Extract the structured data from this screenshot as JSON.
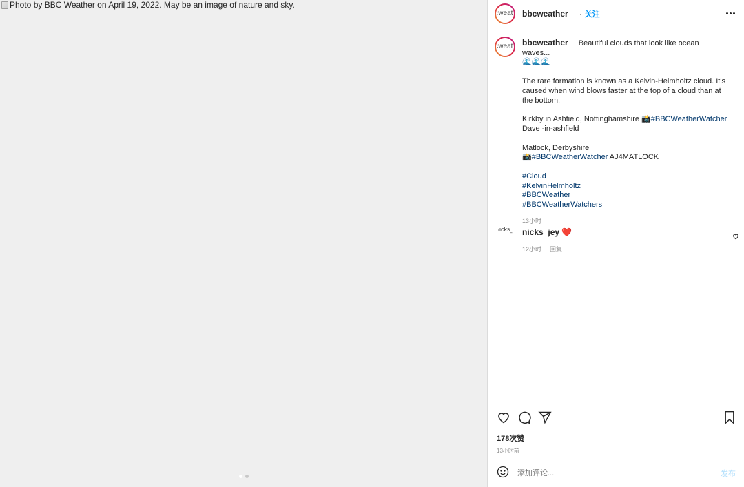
{
  "photo": {
    "alt": "Photo by BBC Weather on April 19, 2022. May be an image of nature and sky.",
    "carousel": {
      "count": 2,
      "active_index": 0
    }
  },
  "header": {
    "username": "bbcweather",
    "avatar_alt": "bbcweather",
    "separator": "·",
    "follow_label": "关注",
    "more_icon": "more-horizontal-icon"
  },
  "caption": {
    "avatar_alt": "bbcweather",
    "username": "bbcweather",
    "line1": "Beautiful clouds that look like ocean waves...",
    "emoji_line": "🌊🌊🌊",
    "para1": "The rare formation is known as a Kelvin-Helmholtz cloud. It's caused when wind blows faster at the top of a cloud than at the bottom.",
    "loc1_text": "Kirkby in Ashfield, Nottinghamshire 📸",
    "loc1_tag": "#BBCWeatherWatcher",
    "loc1_credit": "Dave -in-ashfield",
    "loc2_text": "Matlock, Derbyshire",
    "loc2_camera": "📸",
    "loc2_tag": "#BBCWeatherWatcher",
    "loc2_credit": " AJ4MATLOCK",
    "hashtags": [
      "#Cloud",
      "#KelvinHelmholtz",
      "#BBCWeather",
      "#BBCWeatherWatchers"
    ],
    "time": "13小时"
  },
  "comments": [
    {
      "avatar_alt": "nicks_jey",
      "username": "nicks_jey",
      "emoji": "❤️",
      "time": "12小时",
      "reply_label": "回复"
    }
  ],
  "actions": {
    "likes": "178次赞",
    "posted_ago": "13小时前"
  },
  "comment_box": {
    "placeholder": "添加评论...",
    "post_label": "发布"
  },
  "colors": {
    "link": "#00376b",
    "follow": "#0095f6",
    "post_disabled": "#b2dffc"
  }
}
